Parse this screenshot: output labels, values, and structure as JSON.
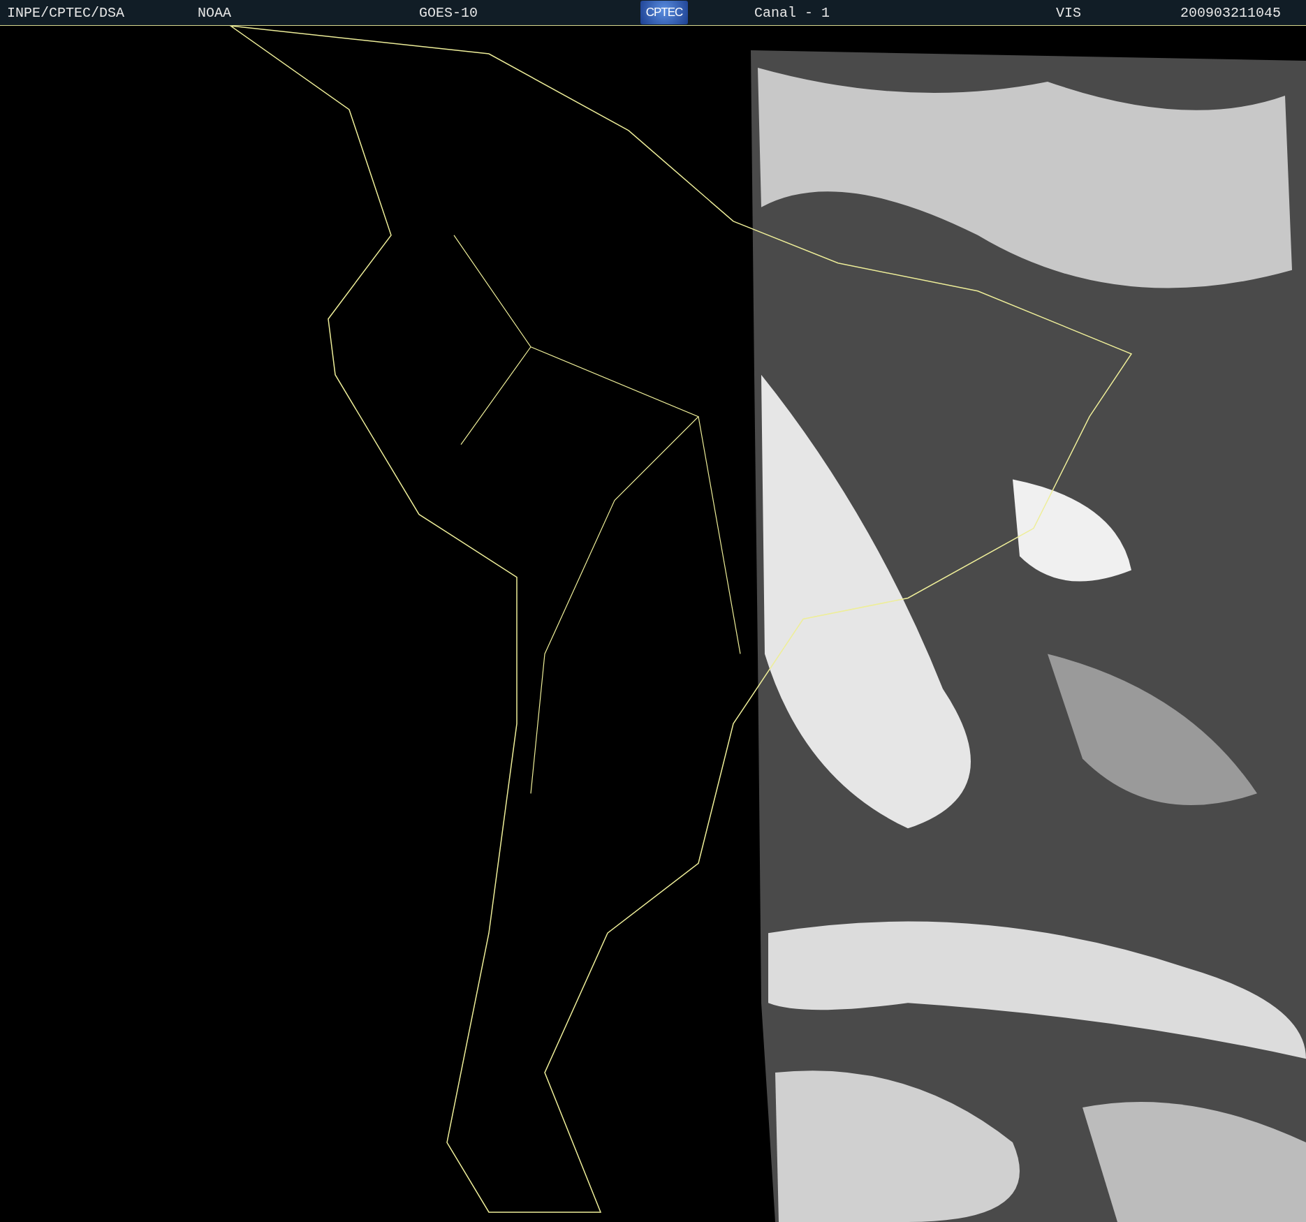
{
  "header": {
    "items": [
      {
        "kind": "text",
        "text": "INPE/CPTEC/DSA"
      },
      {
        "kind": "text",
        "text": "NOAA"
      },
      {
        "kind": "text",
        "text": "GOES-10"
      },
      {
        "kind": "logo",
        "text": "CPTEC"
      },
      {
        "kind": "text",
        "text": "Canal - 1"
      },
      {
        "kind": "text",
        "text": "VIS"
      },
      {
        "kind": "text",
        "text": "200903211045"
      }
    ]
  }
}
